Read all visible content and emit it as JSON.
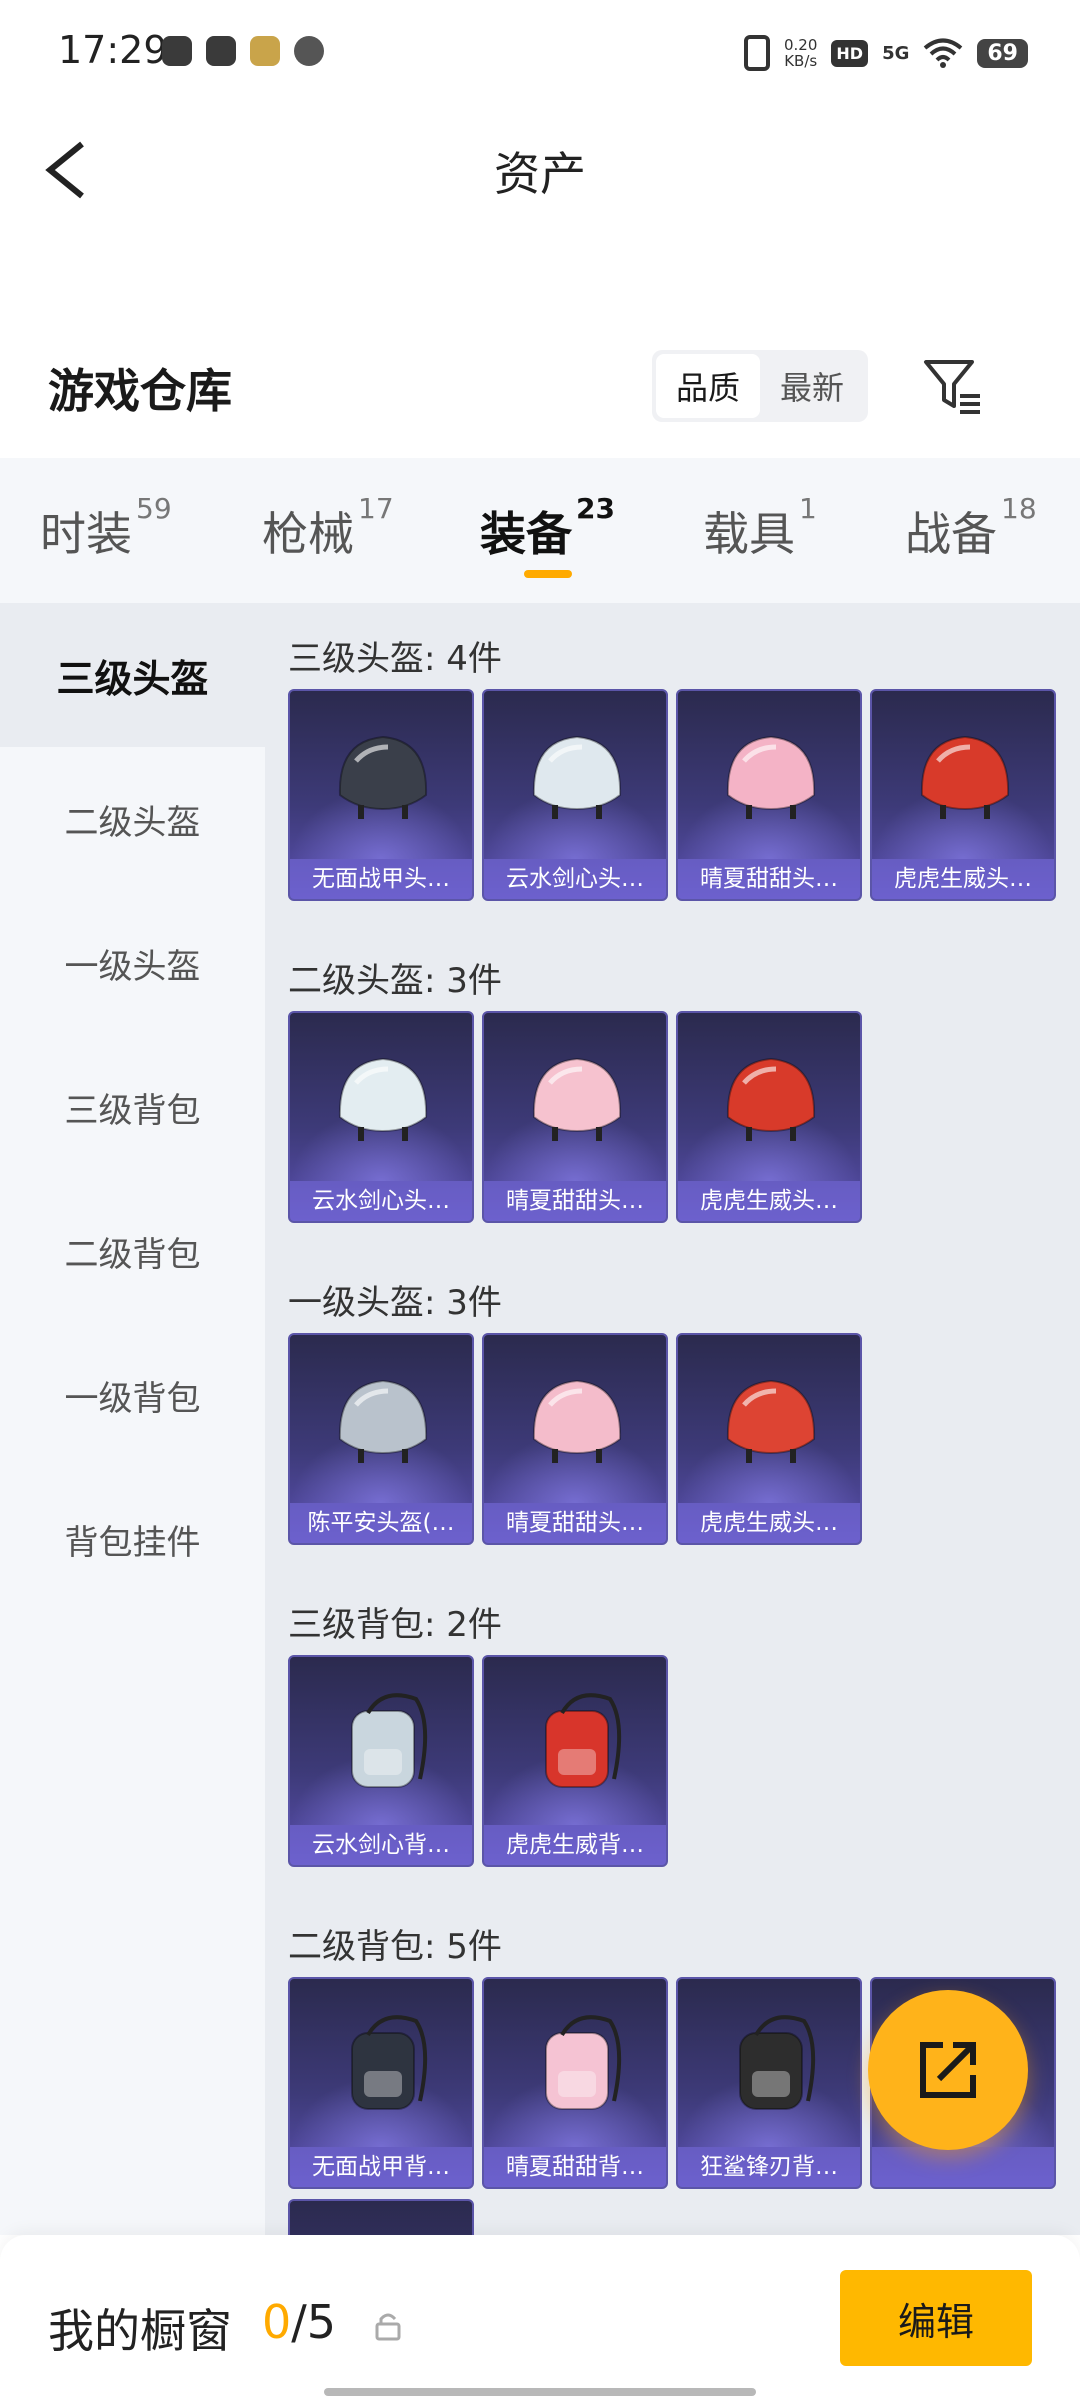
{
  "status_bar": {
    "time": "17:29",
    "speed_value": "0.20",
    "speed_unit": "KB/s",
    "hd": "HD",
    "network": "5G",
    "battery": "69"
  },
  "header": {
    "title": "资产"
  },
  "warehouse": {
    "title": "游戏仓库",
    "sort_options": [
      "品质",
      "最新"
    ],
    "active_sort": "品质"
  },
  "tabs": [
    {
      "label": "时装",
      "count": "59"
    },
    {
      "label": "枪械",
      "count": "17"
    },
    {
      "label": "装备",
      "count": "23",
      "active": true
    },
    {
      "label": "载具",
      "count": "1"
    },
    {
      "label": "战备",
      "count": "18"
    }
  ],
  "sidebar": {
    "items": [
      "三级头盔",
      "二级头盔",
      "一级头盔",
      "三级背包",
      "二级背包",
      "一级背包",
      "背包挂件"
    ],
    "active": "三级头盔"
  },
  "groups": [
    {
      "title": "三级头盔: 4件",
      "items": [
        {
          "label": "无面战甲头…",
          "icon": "helmet-icon",
          "color": "#3a3f4a"
        },
        {
          "label": "云水剑心头…",
          "icon": "helmet-icon",
          "color": "#dfe8ee"
        },
        {
          "label": "晴夏甜甜头…",
          "icon": "helmet-icon",
          "color": "#f4b3c6"
        },
        {
          "label": "虎虎生威头…",
          "icon": "helmet-icon",
          "color": "#d83a2a"
        }
      ]
    },
    {
      "title": "二级头盔: 3件",
      "items": [
        {
          "label": "云水剑心头…",
          "icon": "helmet-icon",
          "color": "#e3edf1"
        },
        {
          "label": "晴夏甜甜头…",
          "icon": "helmet-icon",
          "color": "#f6c2cf"
        },
        {
          "label": "虎虎生威头…",
          "icon": "helmet-icon",
          "color": "#d83a2a"
        }
      ]
    },
    {
      "title": "一级头盔: 3件",
      "items": [
        {
          "label": "陈平安头盔(…",
          "icon": "helmet-icon",
          "color": "#b9c2cc"
        },
        {
          "label": "晴夏甜甜头…",
          "icon": "helmet-icon",
          "color": "#f4bccb"
        },
        {
          "label": "虎虎生威头…",
          "icon": "helmet-icon",
          "color": "#dd4433"
        }
      ]
    },
    {
      "title": "三级背包: 2件",
      "items": [
        {
          "label": "云水剑心背…",
          "icon": "backpack-icon",
          "color": "#c9d6de"
        },
        {
          "label": "虎虎生威背…",
          "icon": "backpack-icon",
          "color": "#d8352b"
        }
      ]
    },
    {
      "title": "二级背包: 5件",
      "items": [
        {
          "label": "无面战甲背…",
          "icon": "backpack-icon",
          "color": "#2e3440"
        },
        {
          "label": "晴夏甜甜背…",
          "icon": "backpack-icon",
          "color": "#f5c3d3"
        },
        {
          "label": "狂鲨锋刃背…",
          "icon": "backpack-icon",
          "color": "#2d2d2d"
        },
        {
          "label": "",
          "icon": "backpack-icon",
          "color": "#333333"
        },
        {
          "label": "",
          "icon": "backpack-icon",
          "color": "#d8352b"
        }
      ]
    }
  ],
  "showcase": {
    "title": "我的橱窗",
    "current": "0",
    "separator": "/",
    "max": "5",
    "edit_label": "编辑"
  },
  "colors": {
    "accent": "#ffb800",
    "card_bg": "#3d3a78",
    "tab_indicator": "#ffaa00"
  }
}
